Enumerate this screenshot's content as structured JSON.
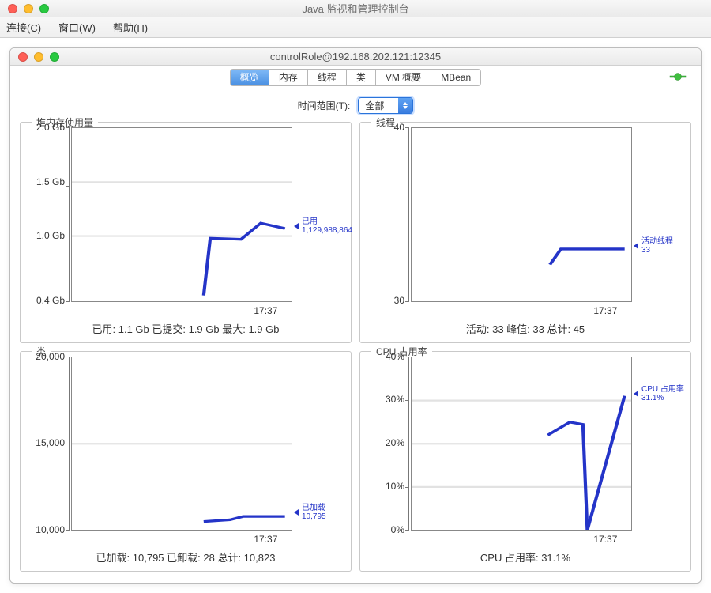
{
  "outer": {
    "title": "Java 监视和管理控制台"
  },
  "menu": {
    "connect": "连接(C)",
    "window": "窗口(W)",
    "help": "帮助(H)"
  },
  "inner": {
    "title": "controlRole@192.168.202.121:12345"
  },
  "tabs": [
    {
      "label": "概览",
      "active": true
    },
    {
      "label": "内存",
      "active": false
    },
    {
      "label": "线程",
      "active": false
    },
    {
      "label": "类",
      "active": false
    },
    {
      "label": "VM 概要",
      "active": false
    },
    {
      "label": "MBean",
      "active": false
    }
  ],
  "timerange": {
    "label": "时间范围(T):",
    "value": "全部"
  },
  "charts": {
    "heap": {
      "title": "堆内存使用量",
      "yaxis": {
        "min": 0.4,
        "max": 2.0,
        "ticks": [
          {
            "v": 2.0,
            "label": "2.0 Gb"
          },
          {
            "v": 1.5,
            "label": "1.5 Gb"
          },
          {
            "v": 1.0,
            "label": "1.0 Gb"
          },
          {
            "v": 0.4,
            "label": "0.4 Gb"
          }
        ]
      },
      "xaxis": {
        "ticks": [
          {
            "p": 0.88,
            "label": "17:37"
          }
        ]
      },
      "series": {
        "name": "已用",
        "value_label": "1,129,988,864",
        "points": [
          {
            "x": 0.6,
            "y": 0.45
          },
          {
            "x": 0.63,
            "y": 0.98
          },
          {
            "x": 0.77,
            "y": 0.97
          },
          {
            "x": 0.86,
            "y": 1.12
          },
          {
            "x": 0.97,
            "y": 1.07
          }
        ],
        "marker_y": 1.07
      },
      "summary": "已用: 1.1 Gb    已提交: 1.9 Gb    最大: 1.9 Gb"
    },
    "threads": {
      "title": "线程",
      "yaxis": {
        "min": 30,
        "max": 40,
        "ticks": [
          {
            "v": 40,
            "label": "40"
          },
          {
            "v": 30,
            "label": "30"
          }
        ]
      },
      "xaxis": {
        "ticks": [
          {
            "p": 0.88,
            "label": "17:37"
          }
        ]
      },
      "series": {
        "name": "活动线程",
        "value_label": "33",
        "points": [
          {
            "x": 0.63,
            "y": 32.1
          },
          {
            "x": 0.68,
            "y": 33
          },
          {
            "x": 0.86,
            "y": 33
          },
          {
            "x": 0.97,
            "y": 33
          }
        ],
        "marker_y": 33
      },
      "summary": "活动: 33    峰值: 33    总计: 45"
    },
    "classes": {
      "title": "类",
      "yaxis": {
        "min": 10000,
        "max": 20000,
        "ticks": [
          {
            "v": 20000,
            "label": "20,000"
          },
          {
            "v": 15000,
            "label": "15,000"
          },
          {
            "v": 10000,
            "label": "10,000"
          }
        ]
      },
      "xaxis": {
        "ticks": [
          {
            "p": 0.88,
            "label": "17:37"
          }
        ]
      },
      "series": {
        "name": "已加载",
        "value_label": "10,795",
        "points": [
          {
            "x": 0.6,
            "y": 10500
          },
          {
            "x": 0.72,
            "y": 10600
          },
          {
            "x": 0.78,
            "y": 10795
          },
          {
            "x": 0.97,
            "y": 10795
          }
        ],
        "marker_y": 10795
      },
      "summary": "已加载: 10,795    已卸载: 28    总计: 10,823"
    },
    "cpu": {
      "title": "CPU 占用率",
      "yaxis": {
        "min": 0,
        "max": 40,
        "ticks": [
          {
            "v": 40,
            "label": "40%"
          },
          {
            "v": 30,
            "label": "30%"
          },
          {
            "v": 20,
            "label": "20%"
          },
          {
            "v": 10,
            "label": "10%"
          },
          {
            "v": 0,
            "label": "0%"
          }
        ]
      },
      "xaxis": {
        "ticks": [
          {
            "p": 0.88,
            "label": "17:37"
          }
        ]
      },
      "series": {
        "name": "CPU 占用率",
        "value_label": "31.1%",
        "points": [
          {
            "x": 0.62,
            "y": 22
          },
          {
            "x": 0.72,
            "y": 25
          },
          {
            "x": 0.78,
            "y": 24.5
          },
          {
            "x": 0.8,
            "y": 0
          },
          {
            "x": 0.97,
            "y": 31.1
          }
        ],
        "marker_y": 31.1
      },
      "summary": "CPU 占用率: 31.1%"
    }
  }
}
